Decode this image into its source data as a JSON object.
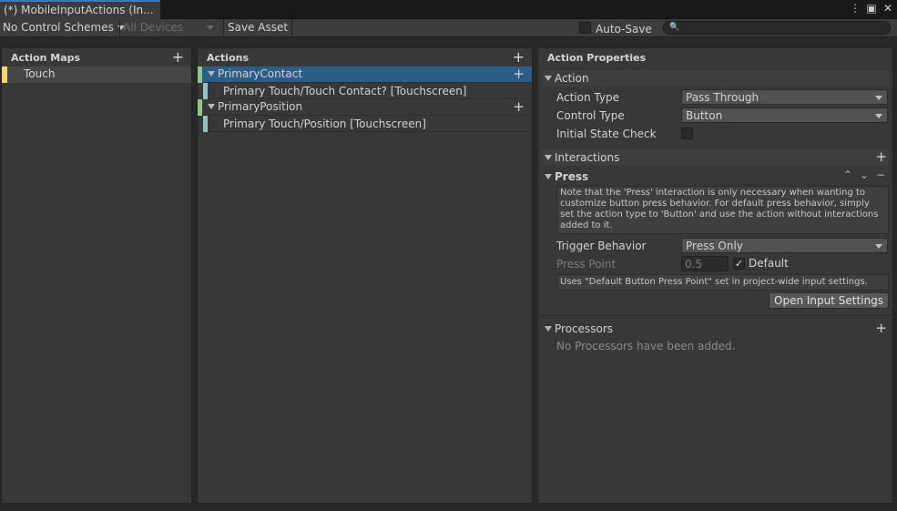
{
  "window": {
    "tab_title": "(*) MobileInputActions (In...",
    "menu_icon": "kebab-menu-icon",
    "maximize_icon": "maximize-icon",
    "close_icon": "close-icon"
  },
  "toolbar": {
    "control_schemes": "No Control Schemes",
    "devices": "All Devices",
    "save_asset": "Save Asset",
    "auto_save_label": "Auto-Save",
    "auto_save_checked": false,
    "search_placeholder": ""
  },
  "action_maps": {
    "header": "Action Maps",
    "items": [
      {
        "label": "Touch",
        "color": "#f2d86a"
      }
    ]
  },
  "actions": {
    "header": "Actions",
    "items": [
      {
        "label": "PrimaryContact",
        "selected": true,
        "binding": "Primary Touch/Touch Contact? [Touchscreen]"
      },
      {
        "label": "PrimaryPosition",
        "selected": false,
        "binding": "Primary Touch/Position [Touchscreen]"
      }
    ]
  },
  "properties": {
    "header": "Action Properties",
    "action_section": "Action",
    "action_type_label": "Action Type",
    "action_type_value": "Pass Through",
    "control_type_label": "Control Type",
    "control_type_value": "Button",
    "initial_state_label": "Initial State Check",
    "initial_state_checked": false,
    "interactions_section": "Interactions",
    "press_section": "Press",
    "press_help": "Note that the 'Press' interaction is only necessary when wanting to customize button press behavior. For default press behavior, simply set the action type to 'Button' and use the action without interactions added to it.",
    "trigger_behavior_label": "Trigger Behavior",
    "trigger_behavior_value": "Press Only",
    "press_point_label": "Press Point",
    "press_point_value": "0.5",
    "default_label": "Default",
    "default_checked": true,
    "press_point_help": "Uses \"Default Button Press Point\" set in project-wide input settings.",
    "open_settings_button": "Open Input Settings",
    "processors_section": "Processors",
    "processors_empty": "No Processors have been added."
  }
}
